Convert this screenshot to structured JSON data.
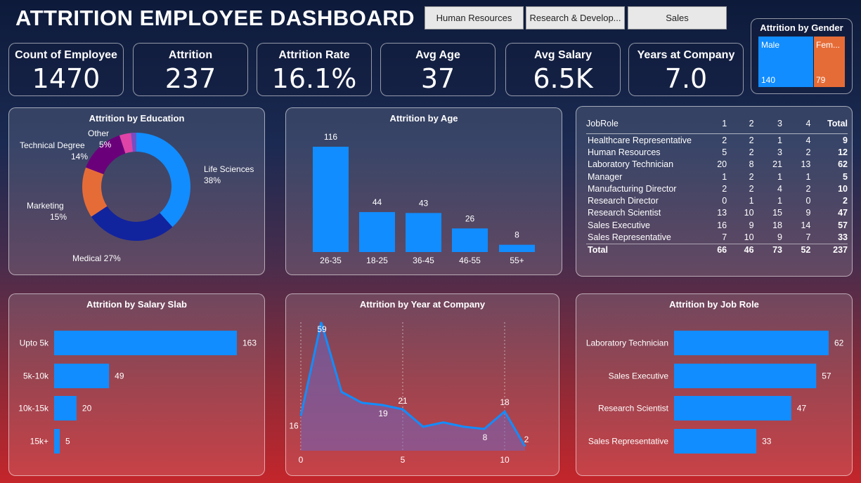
{
  "title": "ATTRITION EMPLOYEE DASHBOARD",
  "slicers": [
    "Human Resources",
    "Research & Develop...",
    "Sales"
  ],
  "kpis": [
    {
      "label": "Count of Employee",
      "value": "1470"
    },
    {
      "label": "Attrition",
      "value": "237"
    },
    {
      "label": "Attrition Rate",
      "value": "16.1%"
    },
    {
      "label": "Avg Age",
      "value": "37"
    },
    {
      "label": "Avg Salary",
      "value": "6.5K"
    },
    {
      "label": "Years at Company",
      "value": "7.0"
    }
  ],
  "gender": {
    "title": "Attrition by Gender",
    "male_label": "Male",
    "male_value": "140",
    "female_label": "Fem...",
    "female_value": "79"
  },
  "colors": {
    "accent": "#118dff",
    "dark_blue": "#12239e",
    "orange": "#e66c37",
    "purple": "#6b007b",
    "pink": "#e044a7",
    "violet": "#744ec2"
  },
  "chart_data": [
    {
      "type": "pie",
      "title": "Attrition by Education",
      "categories": [
        "Life Sciences",
        "Medical",
        "Marketing",
        "Technical Degree",
        "Other"
      ],
      "values": [
        38,
        27,
        15,
        14,
        5
      ],
      "display_labels": [
        "38%",
        "27%",
        "15%",
        "14%",
        "5%"
      ],
      "colors": [
        "#118dff",
        "#12239e",
        "#e66c37",
        "#6b007b",
        "#e044a7",
        "#744ec2"
      ],
      "donut": true
    },
    {
      "type": "bar",
      "title": "Attrition by Age",
      "categories": [
        "26-35",
        "18-25",
        "36-45",
        "46-55",
        "55+"
      ],
      "values": [
        116,
        44,
        43,
        26,
        8
      ]
    },
    {
      "type": "bar",
      "orientation": "horizontal",
      "title": "Attrition by Salary Slab",
      "categories": [
        "Upto 5k",
        "5k-10k",
        "10k-15k",
        "15k+"
      ],
      "values": [
        163,
        49,
        20,
        5
      ]
    },
    {
      "type": "area",
      "title": "Attrition by Year at Company",
      "x": [
        0,
        1,
        2,
        3,
        4,
        5,
        6,
        7,
        8,
        9,
        10,
        11
      ],
      "y": [
        16,
        59,
        27,
        22,
        21,
        19,
        11,
        13,
        11,
        10,
        18,
        2
      ],
      "point_labels": [
        {
          "i": 0,
          "text": "16"
        },
        {
          "i": 1,
          "text": "59"
        },
        {
          "i": 4,
          "text": "19"
        },
        {
          "i": 5,
          "text": "21"
        },
        {
          "i": 9,
          "text": "8"
        },
        {
          "i": 10,
          "text": "18"
        },
        {
          "i": 11,
          "text": "2"
        }
      ],
      "xticks": [
        "0",
        "5",
        "10"
      ]
    },
    {
      "type": "bar",
      "orientation": "horizontal",
      "title": "Attrition by Job Role",
      "categories": [
        "Laboratory Technician",
        "Sales Executive",
        "Research Scientist",
        "Sales Representative"
      ],
      "values": [
        62,
        57,
        47,
        33
      ]
    }
  ],
  "matrix": {
    "header": [
      "JobRole",
      "1",
      "2",
      "3",
      "4",
      "Total"
    ],
    "rows": [
      [
        "Healthcare Representative",
        "2",
        "2",
        "1",
        "4",
        "9"
      ],
      [
        "Human Resources",
        "5",
        "2",
        "3",
        "2",
        "12"
      ],
      [
        "Laboratory Technician",
        "20",
        "8",
        "21",
        "13",
        "62"
      ],
      [
        "Manager",
        "1",
        "2",
        "1",
        "1",
        "5"
      ],
      [
        "Manufacturing Director",
        "2",
        "2",
        "4",
        "2",
        "10"
      ],
      [
        "Research Director",
        "0",
        "1",
        "1",
        "0",
        "2"
      ],
      [
        "Research Scientist",
        "13",
        "10",
        "15",
        "9",
        "47"
      ],
      [
        "Sales Executive",
        "16",
        "9",
        "18",
        "14",
        "57"
      ],
      [
        "Sales Representative",
        "7",
        "10",
        "9",
        "7",
        "33"
      ]
    ],
    "total": [
      "Total",
      "66",
      "46",
      "73",
      "52",
      "237"
    ]
  }
}
